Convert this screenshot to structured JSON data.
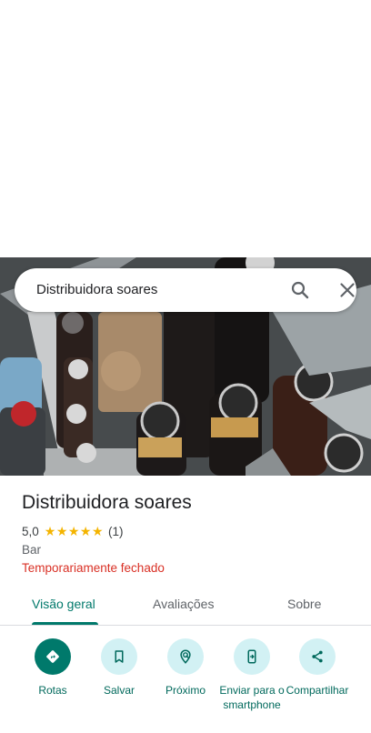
{
  "search": {
    "query": "Distribuidora soares",
    "search_icon": "search-icon",
    "close_icon": "close-icon"
  },
  "place": {
    "name": "Distribuidora soares",
    "rating": "5,0",
    "stars": "★★★★★",
    "review_count": "(1)",
    "category": "Bar",
    "status": "Temporariamente fechado"
  },
  "tabs": [
    {
      "label": "Visão geral",
      "active": true
    },
    {
      "label": "Avaliações",
      "active": false
    },
    {
      "label": "Sobre",
      "active": false
    }
  ],
  "actions": [
    {
      "label": "Rotas",
      "icon": "directions-icon"
    },
    {
      "label": "Salvar",
      "icon": "bookmark-icon"
    },
    {
      "label": "Próximo",
      "icon": "nearby-icon"
    },
    {
      "label": "Enviar para o smartphone",
      "icon": "send-to-phone-icon"
    },
    {
      "label": "Compartilhar",
      "icon": "share-icon"
    }
  ],
  "colors": {
    "accent": "#00796b",
    "action_bg": "#d2f1f4",
    "status_red": "#d93025",
    "star": "#f4b400"
  }
}
